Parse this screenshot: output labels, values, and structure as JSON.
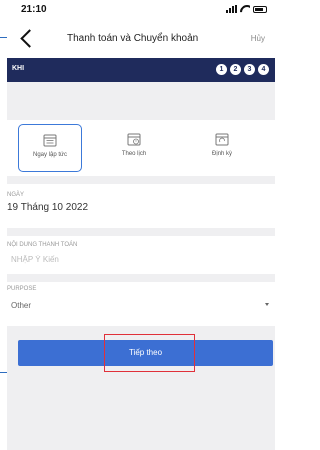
{
  "status_bar": {
    "time": "21:10"
  },
  "header": {
    "title": "Thanh toán và Chuyển khoản",
    "cancel_label": "Hủy"
  },
  "stepbar": {
    "label": "KHI",
    "steps": [
      "1",
      "2",
      "3",
      "4"
    ]
  },
  "schedule_options": [
    {
      "label": "Ngay lập tức",
      "icon": "calendar-list-icon",
      "selected": true
    },
    {
      "label": "Theo lịch",
      "icon": "calendar-clock-icon",
      "selected": false
    },
    {
      "label": "Định kỳ",
      "icon": "calendar-repeat-icon",
      "selected": false
    }
  ],
  "date_field": {
    "label": "NGÀY",
    "value": "19 Tháng 10 2022"
  },
  "content_field": {
    "label": "NỘI DUNG THANH TOÁN",
    "placeholder": "NHẬP Ý Kiến",
    "value": ""
  },
  "purpose_field": {
    "label": "PURPOSE",
    "value": "Other"
  },
  "next_button": {
    "label": "Tiếp theo"
  },
  "colors": {
    "stepbar": "#1f2b5c",
    "accent": "#3c6fd3",
    "highlight": "#e0303a"
  }
}
